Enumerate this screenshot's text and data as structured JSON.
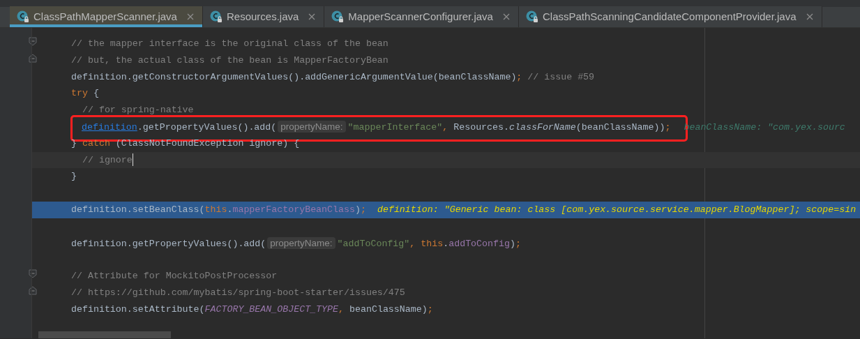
{
  "tabs": [
    {
      "label": "ClassPathMapperScanner.java",
      "selected": true
    },
    {
      "label": "Resources.java",
      "selected": false
    },
    {
      "label": "MapperScannerConfigurer.java",
      "selected": false
    },
    {
      "label": "ClassPathScanningCandidateComponentProvider.java",
      "selected": false
    }
  ],
  "lines": [
    {
      "kind": "code",
      "fold_start": true,
      "tokens": [
        {
          "kind": "comment",
          "text": "// the mapper interface is the original class of the bean"
        }
      ]
    },
    {
      "kind": "code",
      "fold_end": true,
      "tokens": [
        {
          "kind": "comment",
          "text": "// but, the actual class of the bean is MapperFactoryBean"
        }
      ]
    },
    {
      "kind": "code",
      "tokens": [
        {
          "kind": "plain",
          "text": "definition.getConstructorArgumentValues().addGenericArgumentValue(beanClassName)"
        },
        {
          "kind": "keyword",
          "text": ";"
        },
        {
          "kind": "comment",
          "text": "// issue #59"
        }
      ]
    },
    {
      "kind": "code",
      "tokens": [
        {
          "kind": "keyword",
          "text": "try"
        },
        {
          "kind": "plain",
          "text": " {"
        }
      ]
    },
    {
      "kind": "code",
      "tokens": [
        {
          "kind": "comment",
          "text": "  // for spring-native"
        }
      ]
    },
    {
      "kind": "code",
      "boxed": true,
      "tokens": [
        {
          "kind": "link",
          "text": "definition"
        },
        {
          "kind": "plain",
          "text": ".getPropertyValues().add("
        },
        {
          "kind": "hint",
          "text": "propertyName:"
        },
        {
          "kind": "string",
          "text": "\"mapperInterface\""
        },
        {
          "kind": "keyword",
          "text": ", "
        },
        {
          "kind": "plain",
          "text": "Resources."
        },
        {
          "kind": "static",
          "text": "classForName"
        },
        {
          "kind": "plain",
          "text": "(beanClassName))"
        },
        {
          "kind": "keyword",
          "text": ";"
        }
      ],
      "debug": "beanClassName: \"com.yex.sourc"
    },
    {
      "kind": "code",
      "tokens": [
        {
          "kind": "plain",
          "text": "} "
        },
        {
          "kind": "keyword",
          "text": "catch"
        },
        {
          "kind": "plain",
          "text": " (ClassNotFoundException ignore) {"
        }
      ]
    },
    {
      "kind": "code",
      "caret": true,
      "tokens": [
        {
          "kind": "comment",
          "text": "  // ignore"
        }
      ]
    },
    {
      "kind": "code",
      "tokens": [
        {
          "kind": "plain",
          "text": "}"
        }
      ]
    },
    {
      "kind": "blank"
    },
    {
      "kind": "code",
      "highlighted": true,
      "tokens": [
        {
          "kind": "plain",
          "text": "definition.setBeanClass("
        },
        {
          "kind": "keyword",
          "text": "this"
        },
        {
          "kind": "plain",
          "text": "."
        },
        {
          "kind": "field",
          "text": "mapperFactoryBeanClass"
        },
        {
          "kind": "plain",
          "text": ")"
        },
        {
          "kind": "keyword",
          "text": ";"
        }
      ],
      "debug": "definition: \"Generic bean: class [com.yex.source.service.mapper.BlogMapper]; scope=sin"
    },
    {
      "kind": "blank"
    },
    {
      "kind": "code",
      "tokens": [
        {
          "kind": "plain",
          "text": "definition.getPropertyValues().add("
        },
        {
          "kind": "hint",
          "text": "propertyName:"
        },
        {
          "kind": "string",
          "text": "\"addToConfig\""
        },
        {
          "kind": "keyword",
          "text": ", this"
        },
        {
          "kind": "plain",
          "text": "."
        },
        {
          "kind": "field",
          "text": "addToConfig"
        },
        {
          "kind": "plain",
          "text": ")"
        },
        {
          "kind": "keyword",
          "text": ";"
        }
      ]
    },
    {
      "kind": "blank"
    },
    {
      "kind": "code",
      "fold_start": true,
      "tokens": [
        {
          "kind": "comment",
          "text": "// Attribute for MockitoPostProcessor"
        }
      ]
    },
    {
      "kind": "code",
      "fold_end": true,
      "tokens": [
        {
          "kind": "comment",
          "text": "// https://github.com/mybatis/spring-boot-starter/issues/475"
        }
      ]
    },
    {
      "kind": "code",
      "tokens": [
        {
          "kind": "plain",
          "text": "definition.setAttribute("
        },
        {
          "kind": "constant",
          "text": "FACTORY_BEAN_OBJECT_TYPE"
        },
        {
          "kind": "keyword",
          "text": ", "
        },
        {
          "kind": "plain",
          "text": "beanClassName)"
        },
        {
          "kind": "keyword",
          "text": ";"
        }
      ]
    },
    {
      "kind": "blank"
    }
  ]
}
